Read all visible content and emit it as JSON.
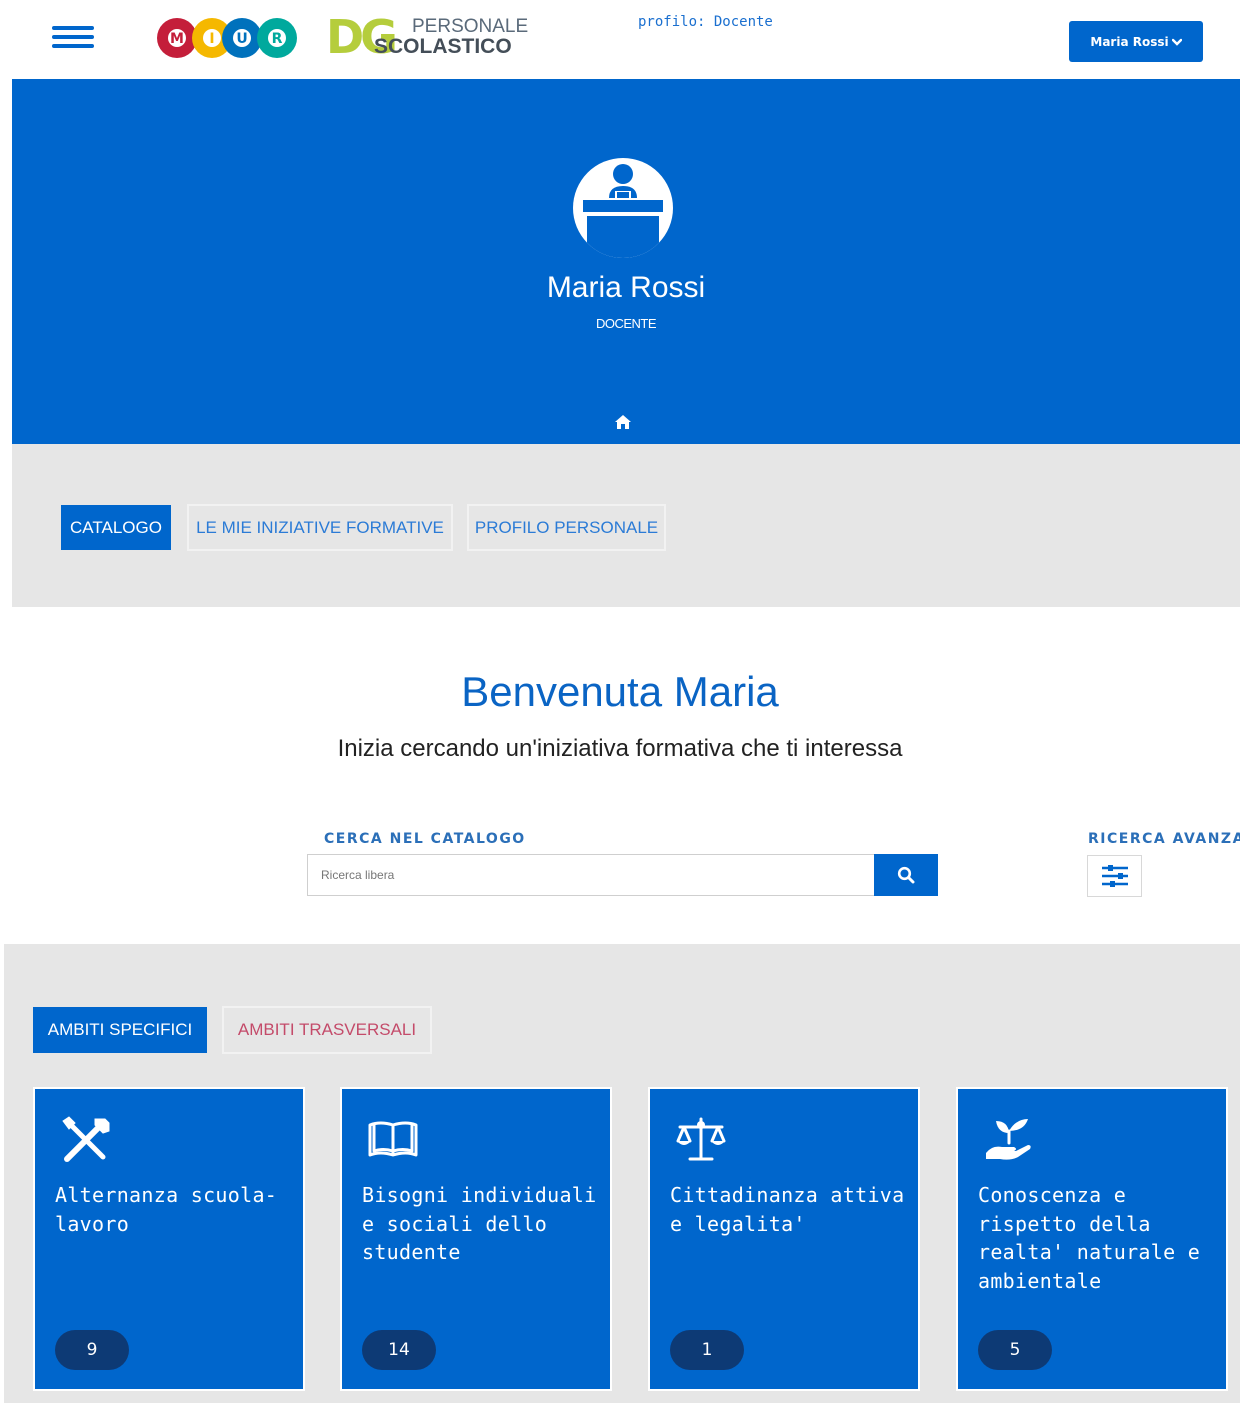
{
  "header": {
    "menu_icon": "hamburger-menu-icon",
    "logo_letters": [
      "M",
      "I",
      "U",
      "R"
    ],
    "logo_colors": [
      "#c41e3a",
      "#f5b800",
      "#0071bc",
      "#00a99d"
    ],
    "dg_logo_initials": "DG",
    "dg_logo_line1": "PERSONALE",
    "dg_logo_line2": "SCOLASTICO",
    "profile_text": "profilo: Docente",
    "user_button_label": "Maria Rossi",
    "user_button_icon": "chevron-down-icon"
  },
  "hero": {
    "avatar_icon": "teacher-at-desk-icon",
    "name": "Maria Rossi",
    "role": "DOCENTE",
    "home_icon": "home-icon"
  },
  "nav_tabs": [
    {
      "label": "CATALOGO",
      "active": true
    },
    {
      "label": "LE MIE INIZIATIVE FORMATIVE",
      "active": false
    },
    {
      "label": "PROFILO PERSONALE",
      "active": false
    }
  ],
  "welcome": {
    "title": "Benvenuta Maria",
    "subtitle": "Inizia cercando un'iniziativa formativa che ti interessa"
  },
  "search": {
    "label": "CERCA NEL CATALOGO",
    "placeholder": "Ricerca libera",
    "value": "",
    "button_icon": "search-icon",
    "advanced_label": "RICERCA AVANZATA",
    "advanced_icon": "sliders-icon"
  },
  "ambiti_tabs": [
    {
      "label": "AMBITI SPECIFICI",
      "active": true
    },
    {
      "label": "AMBITI TRASVERSALI",
      "active": false
    }
  ],
  "cards": [
    {
      "title": "Alternanza scuola-lavoro",
      "count": "9",
      "icon": "tools-icon"
    },
    {
      "title": "Bisogni individuali e sociali dello studente",
      "count": "14",
      "icon": "open-book-icon"
    },
    {
      "title": "Cittadinanza attiva e legalita'",
      "count": "1",
      "icon": "balance-scale-icon"
    },
    {
      "title": "Conoscenza e rispetto della realta' naturale e ambientale",
      "count": "5",
      "icon": "hand-plant-icon"
    }
  ],
  "colors": {
    "primary": "#0066cc",
    "band_gray": "#e6e6e6",
    "count_pill": "#0d3a75",
    "inactive_tab_text": "#2b7bd6",
    "trasversali_text": "#c44b6a",
    "dg_green": "#b5cd3c"
  }
}
